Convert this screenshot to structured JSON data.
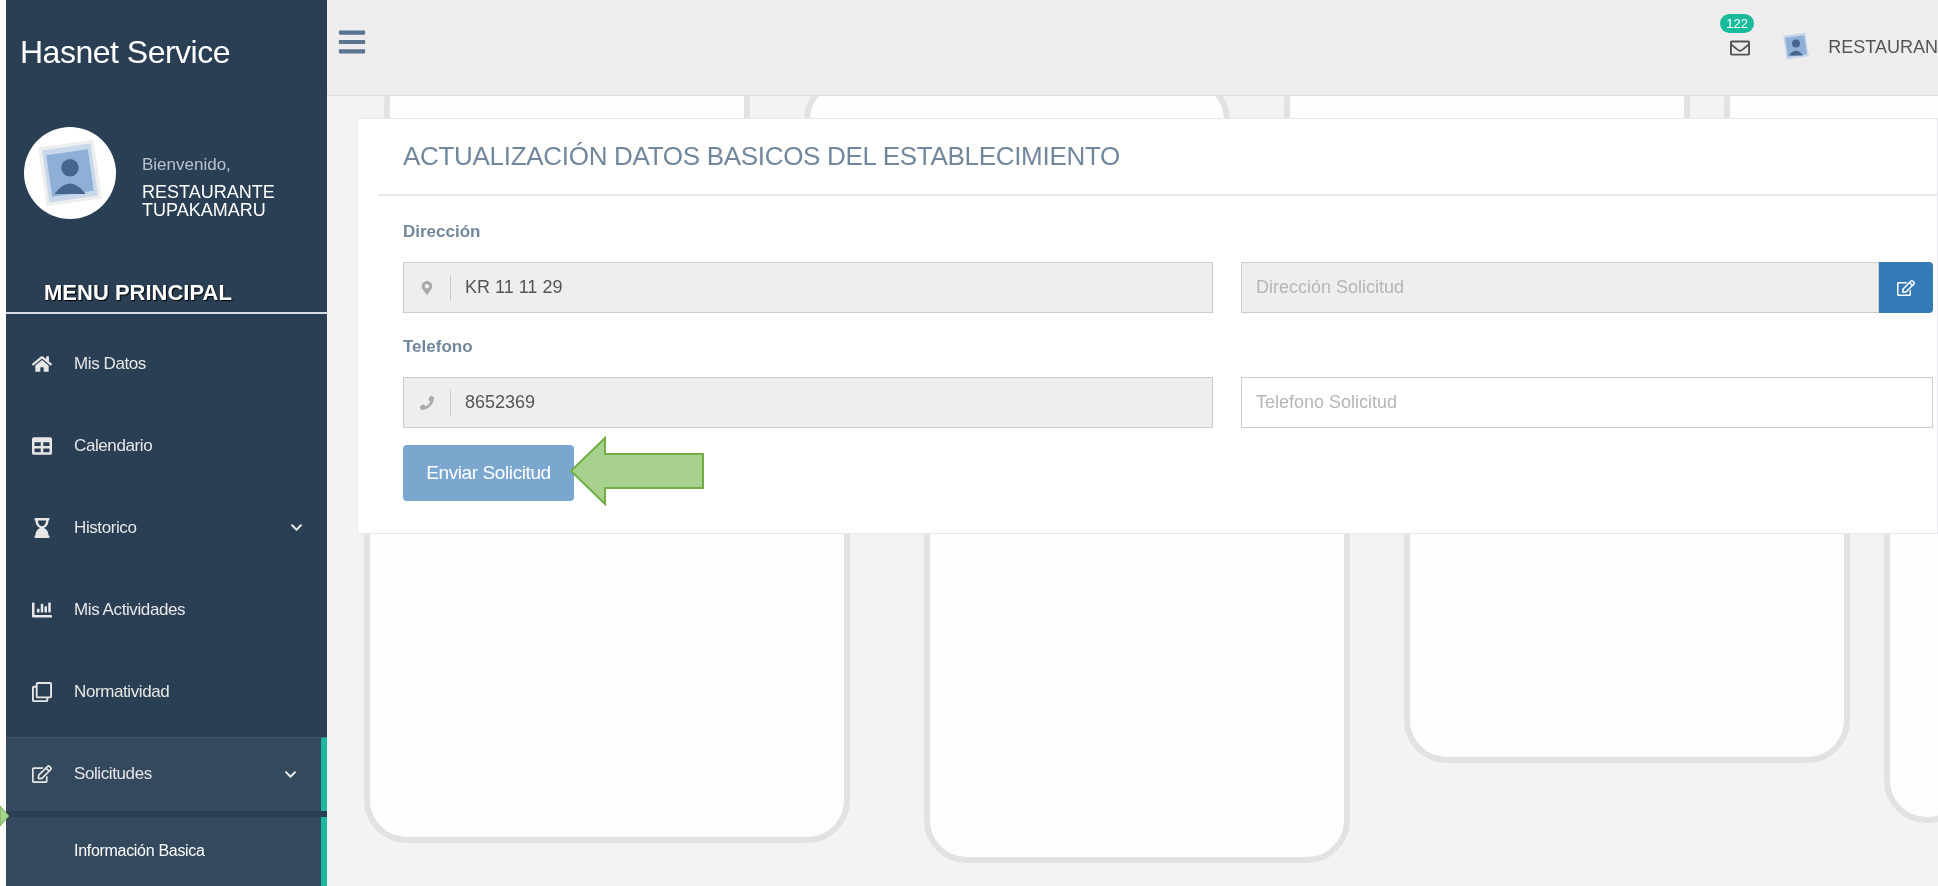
{
  "sidebar": {
    "brand": "Hasnet Service",
    "greeting": "Bienvenido,",
    "user_name": "RESTAURANTE TUPAKAMARU",
    "menu_title": "MENU PRINCIPAL",
    "items": [
      {
        "label": "Mis Datos",
        "expandable": false,
        "selected": false
      },
      {
        "label": "Calendario",
        "expandable": false,
        "selected": false
      },
      {
        "label": "Historico",
        "expandable": true,
        "selected": false
      },
      {
        "label": "Mis Actividades",
        "expandable": false,
        "selected": false
      },
      {
        "label": "Normatividad",
        "expandable": false,
        "selected": false
      },
      {
        "label": "Solicitudes",
        "expandable": true,
        "selected": true,
        "children": [
          {
            "label": "Información Basica",
            "selected": true
          }
        ]
      }
    ]
  },
  "top_bar": {
    "notification_count": "122",
    "user_name": "RESTAURAN"
  },
  "form": {
    "title": "ACTUALIZACIÓN DATOS BASICOS DEL ESTABLECIMIENTO",
    "fields": [
      {
        "label": "Dirección",
        "value": "KR 11 11 29",
        "disabled": true,
        "request_placeholder": "Dirección Solicitud",
        "request_disabled": true,
        "edit_button": true
      },
      {
        "label": "Telefono",
        "value": "8652369",
        "disabled": true,
        "request_placeholder": "Telefono Solicitud",
        "request_disabled": false,
        "edit_button": false
      }
    ],
    "submit": "Enviar Solicitud"
  }
}
